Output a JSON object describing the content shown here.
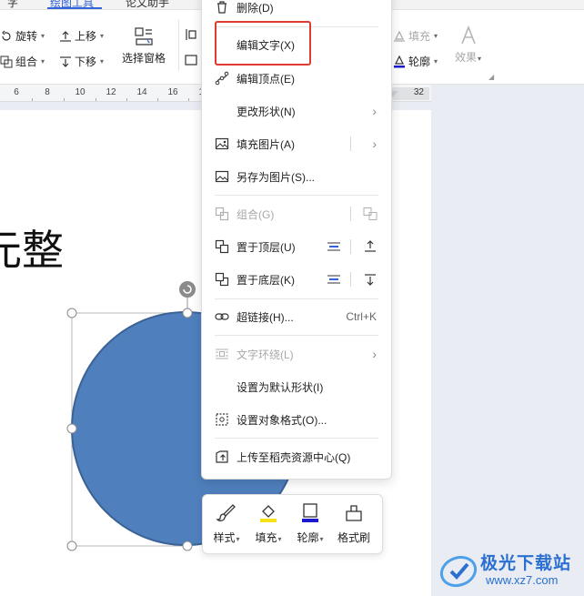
{
  "ribbon": {
    "tab_fragments": [
      "字",
      "绘图工具",
      "论文助手"
    ],
    "buttons": {
      "rotate": "旋转",
      "group": "组合",
      "bring_up": "上移",
      "send_down": "下移",
      "selection_pane": "选择窗格",
      "fill": "填充",
      "outline": "轮廓",
      "effects": "效果"
    }
  },
  "ruler": {
    "numbers": [
      "6",
      "8",
      "10",
      "12",
      "14",
      "16",
      "18"
    ],
    "end_number": "32"
  },
  "document": {
    "text": "元整"
  },
  "context_menu": {
    "items": [
      {
        "label": "删除(D)",
        "icon": "trash-icon",
        "disabled": false
      },
      {
        "label": "编辑文字(X)",
        "icon": "",
        "disabled": false
      },
      {
        "label": "编辑顶点(E)",
        "icon": "edit-points-icon",
        "disabled": false
      },
      {
        "label": "更改形状(N)",
        "icon": "",
        "disabled": false,
        "submenu": true
      },
      {
        "label": "填充图片(A)",
        "icon": "fill-picture-icon",
        "disabled": false,
        "submenu": true
      },
      {
        "label": "另存为图片(S)...",
        "icon": "save-picture-icon",
        "disabled": false
      },
      {
        "label": "组合(G)",
        "icon": "group-icon",
        "disabled": true
      },
      {
        "label": "置于顶层(U)",
        "icon": "bring-to-front-icon",
        "disabled": false
      },
      {
        "label": "置于底层(K)",
        "icon": "send-to-back-icon",
        "disabled": false
      },
      {
        "label": "超链接(H)...",
        "icon": "hyperlink-icon",
        "shortcut": "Ctrl+K",
        "disabled": false
      },
      {
        "label": "文字环绕(L)",
        "icon": "text-wrap-icon",
        "disabled": true,
        "submenu": true
      },
      {
        "label": "设置为默认形状(I)",
        "icon": "",
        "disabled": false
      },
      {
        "label": "设置对象格式(O)...",
        "icon": "format-object-icon",
        "disabled": false
      },
      {
        "label": "上传至稻壳资源中心(Q)",
        "icon": "upload-icon",
        "disabled": false
      }
    ]
  },
  "float_toolbar": {
    "style": "样式",
    "fill": "填充",
    "outline": "轮廓",
    "format_painter": "格式刷"
  },
  "watermark": {
    "title": "极光下载站",
    "url": "www.xz7.com"
  },
  "colors": {
    "accent": "#3363d9",
    "shape_fill": "#4f7fbd",
    "shape_stroke": "#3b6294",
    "highlight_box": "#e03a33",
    "fill_swatch": "#f5e21b",
    "outline_swatch": "#1a1acc"
  }
}
